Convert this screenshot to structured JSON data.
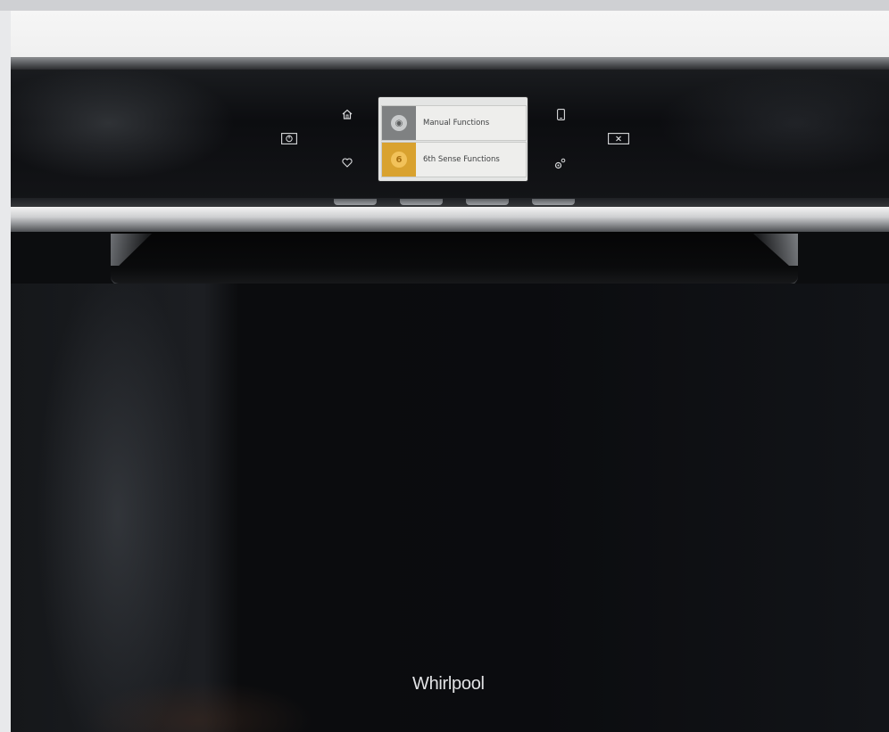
{
  "display": {
    "header": "",
    "items": [
      {
        "label": "Manual Functions",
        "icon": "manual-functions-icon",
        "color": "#7f8182"
      },
      {
        "label": "6th Sense Functions",
        "icon": "6th-sense-icon",
        "color": "#d9a22f"
      }
    ]
  },
  "controls": {
    "power": "power-icon",
    "home": "home-icon",
    "favourites": "heart-icon",
    "mobile": "smartphone-icon",
    "tools": "settings-icon",
    "cancel": "close-icon"
  },
  "brand": {
    "name": "Whirlpool"
  },
  "colors": {
    "glass": "#0c0d0f",
    "steel": "#cfd0d2",
    "accent_gold": "#d9a22f"
  }
}
